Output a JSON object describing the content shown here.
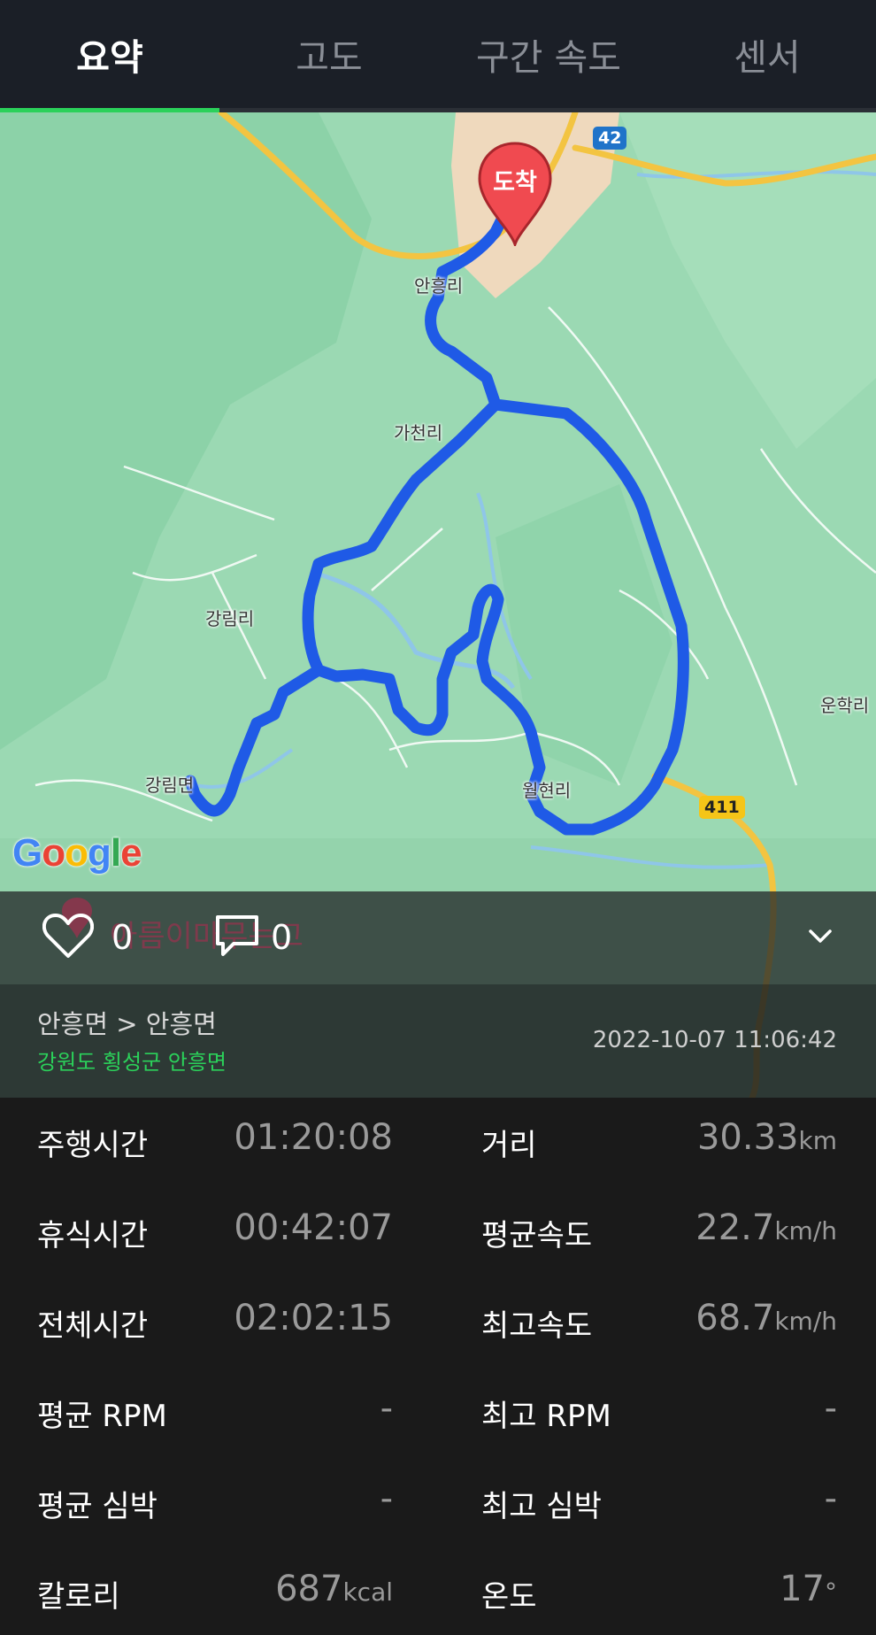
{
  "tabs": [
    {
      "label": "요약"
    },
    {
      "label": "고도"
    },
    {
      "label": "구간 속도"
    },
    {
      "label": "센서"
    }
  ],
  "map": {
    "places": [
      "안흥리",
      "가천리",
      "강림리",
      "운학리",
      "강림면",
      "월현리"
    ],
    "road_badges": [
      "42",
      "411"
    ],
    "arrival_pin": "도착",
    "google_logo": "Google",
    "accent_route_color": "#1f5ae6"
  },
  "social": {
    "likes": "0",
    "comments": "0",
    "ghost_title": "아름이마무는고"
  },
  "location": {
    "route": "안흥면 > 안흥면",
    "region": "강원도 횡성군 안흥면",
    "datetime": "2022-10-07 11:06:42"
  },
  "stats": {
    "moving_time": {
      "label": "주행시간",
      "value": "01:20:08"
    },
    "rest_time": {
      "label": "휴식시간",
      "value": "00:42:07"
    },
    "total_time": {
      "label": "전체시간",
      "value": "02:02:15"
    },
    "avg_rpm": {
      "label": "평균 RPM",
      "value": "-"
    },
    "avg_hr": {
      "label": "평균 심박",
      "value": "-"
    },
    "calories": {
      "label": "칼로리",
      "value": "687",
      "unit": "kcal"
    },
    "distance": {
      "label": "거리",
      "value": "30.33",
      "unit": "km"
    },
    "avg_speed": {
      "label": "평균속도",
      "value": "22.7",
      "unit": "km/h"
    },
    "max_speed": {
      "label": "최고속도",
      "value": "68.7",
      "unit": "km/h"
    },
    "max_rpm": {
      "label": "최고 RPM",
      "value": "-"
    },
    "max_hr": {
      "label": "최고 심박",
      "value": "-"
    },
    "temperature": {
      "label": "온도",
      "value": "17",
      "unit": "°"
    }
  },
  "colors": {
    "accent_green": "#2bd15a",
    "tab_bg": "#1b1f27",
    "pin_red": "#f04a50"
  }
}
